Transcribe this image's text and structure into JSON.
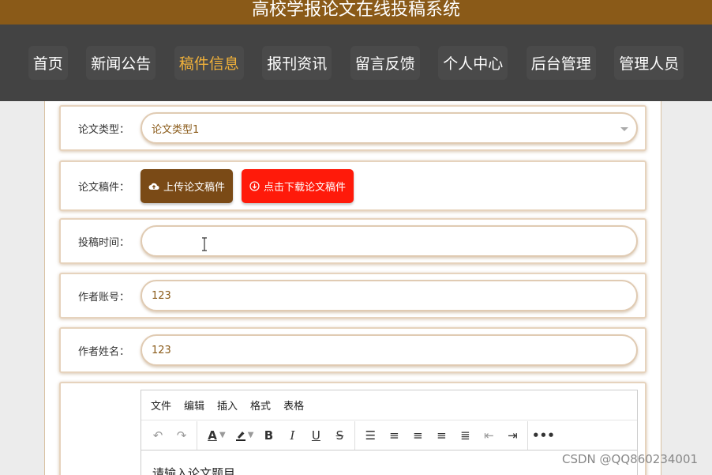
{
  "banner": {
    "title": "高校学报论文在线投稿系统"
  },
  "nav": {
    "items": [
      {
        "label": "首页"
      },
      {
        "label": "新闻公告"
      },
      {
        "label": "稿件信息"
      },
      {
        "label": "报刊资讯"
      },
      {
        "label": "留言反馈"
      },
      {
        "label": "个人中心"
      },
      {
        "label": "后台管理"
      },
      {
        "label": "管理人员"
      }
    ],
    "active": "稿件信息",
    "active_color": "#f2b23a"
  },
  "form": {
    "paper_type": {
      "label": "论文类型：",
      "value": "论文类型1"
    },
    "paper_file": {
      "label": "论文稿件：",
      "upload_label": "上传论文稿件",
      "download_label": "点击下载论文稿件"
    },
    "submit_time": {
      "label": "投稿时间：",
      "value": ""
    },
    "author_account": {
      "label": "作者账号：",
      "value": "123"
    },
    "author_name": {
      "label": "作者姓名：",
      "value": "123"
    }
  },
  "editor": {
    "menu": [
      "文件",
      "编辑",
      "插入",
      "格式",
      "表格"
    ],
    "placeholder": "请输入论文题目"
  },
  "icons": {
    "upload": "cloud-upload-icon",
    "download": "download-circle-icon"
  },
  "colors": {
    "banner": "#8a5a18",
    "navbar": "#434343",
    "upload_btn": "#7a4a16",
    "download_btn": "#ff1a0a"
  },
  "watermark": "CSDN @QQ860234001"
}
